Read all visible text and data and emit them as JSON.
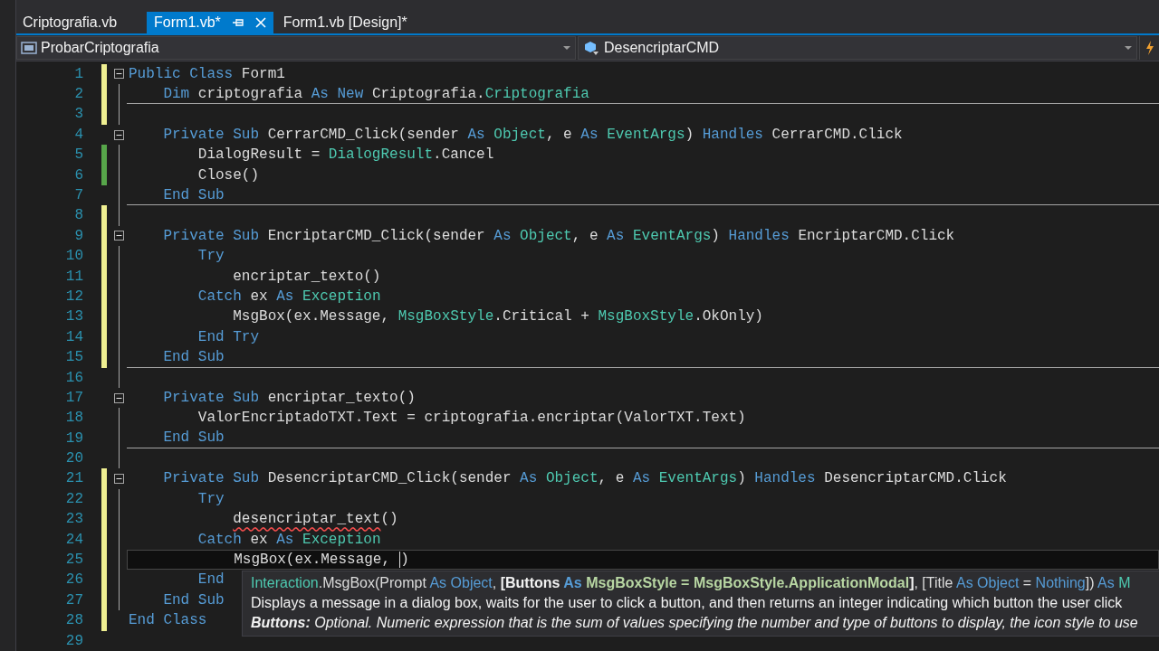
{
  "tabs": [
    {
      "label": "Criptografia.vb",
      "selected": false
    },
    {
      "label": "Form1.vb*",
      "selected": true
    },
    {
      "label": "Form1.vb [Design]*",
      "selected": false
    }
  ],
  "nav": {
    "class_dropdown": "ProbarCriptografia",
    "member_dropdown": "DesencriptarCMD"
  },
  "editor": {
    "lines": [
      {
        "number": "1",
        "color": "#efef91",
        "collapsible": true,
        "tokens": [
          {
            "kind": "keyword",
            "text": "Public Class"
          },
          {
            "kind": "plain",
            "text": " Form1"
          }
        ]
      },
      {
        "number": "2",
        "color": "#efef91",
        "separator": true,
        "tokens": [
          {
            "kind": "keyword",
            "text": "    Dim"
          },
          {
            "kind": "plain",
            "text": " criptografia "
          },
          {
            "kind": "keyword",
            "text": "As New"
          },
          {
            "kind": "plain",
            "text": " Criptografia."
          },
          {
            "kind": "type",
            "text": "Criptografia"
          }
        ]
      },
      {
        "number": "3",
        "color": "#efef91"
      },
      {
        "number": "4",
        "collapsible": true,
        "tokens": [
          {
            "kind": "keyword",
            "text": "    Private Sub"
          },
          {
            "kind": "plain",
            "text": " CerrarCMD_Click(sender "
          },
          {
            "kind": "keyword",
            "text": "As"
          },
          {
            "kind": "type",
            "text": " Object"
          },
          {
            "kind": "plain",
            "text": ", e "
          },
          {
            "kind": "keyword",
            "text": "As"
          },
          {
            "kind": "type",
            "text": " EventArgs"
          },
          {
            "kind": "plain",
            "text": ") "
          },
          {
            "kind": "keyword",
            "text": "Handles"
          },
          {
            "kind": "plain",
            "text": " CerrarCMD.Click"
          }
        ]
      },
      {
        "number": "5",
        "color": "#57a64a",
        "tokens": [
          {
            "kind": "plain",
            "text": "        DialogResult = "
          },
          {
            "kind": "type",
            "text": "DialogResult"
          },
          {
            "kind": "plain",
            "text": ".Cancel"
          }
        ]
      },
      {
        "number": "6",
        "color": "#57a64a",
        "tokens": [
          {
            "kind": "plain",
            "text": "        Close()"
          }
        ]
      },
      {
        "number": "7",
        "separator": true,
        "tokens": [
          {
            "kind": "keyword",
            "text": "    End Sub"
          }
        ]
      },
      {
        "number": "8",
        "color": "#efef91"
      },
      {
        "number": "9",
        "color": "#efef91",
        "collapsible": true,
        "tokens": [
          {
            "kind": "keyword",
            "text": "    Private Sub"
          },
          {
            "kind": "plain",
            "text": " EncriptarCMD_Click(sender "
          },
          {
            "kind": "keyword",
            "text": "As"
          },
          {
            "kind": "type",
            "text": " Object"
          },
          {
            "kind": "plain",
            "text": ", e "
          },
          {
            "kind": "keyword",
            "text": "As"
          },
          {
            "kind": "type",
            "text": " EventArgs"
          },
          {
            "kind": "plain",
            "text": ") "
          },
          {
            "kind": "keyword",
            "text": "Handles"
          },
          {
            "kind": "plain",
            "text": " EncriptarCMD.Click"
          }
        ]
      },
      {
        "number": "10",
        "color": "#efef91",
        "tokens": [
          {
            "kind": "keyword",
            "text": "        Try"
          }
        ]
      },
      {
        "number": "11",
        "color": "#efef91",
        "tokens": [
          {
            "kind": "plain",
            "text": "            encriptar_texto()"
          }
        ]
      },
      {
        "number": "12",
        "color": "#efef91",
        "tokens": [
          {
            "kind": "keyword",
            "text": "        Catch"
          },
          {
            "kind": "plain",
            "text": " ex "
          },
          {
            "kind": "keyword",
            "text": "As"
          },
          {
            "kind": "type",
            "text": " Exception"
          }
        ]
      },
      {
        "number": "13",
        "color": "#efef91",
        "tokens": [
          {
            "kind": "plain",
            "text": "            MsgBox(ex.Message, "
          },
          {
            "kind": "type",
            "text": "MsgBoxStyle"
          },
          {
            "kind": "plain",
            "text": ".Critical + "
          },
          {
            "kind": "type",
            "text": "MsgBoxStyle"
          },
          {
            "kind": "plain",
            "text": ".OkOnly)"
          }
        ]
      },
      {
        "number": "14",
        "color": "#efef91",
        "tokens": [
          {
            "kind": "keyword",
            "text": "        End Try"
          }
        ]
      },
      {
        "number": "15",
        "color": "#efef91",
        "separator": true,
        "tokens": [
          {
            "kind": "keyword",
            "text": "    End Sub"
          }
        ]
      },
      {
        "number": "16"
      },
      {
        "number": "17",
        "collapsible": true,
        "tokens": [
          {
            "kind": "keyword",
            "text": "    Private Sub"
          },
          {
            "kind": "plain",
            "text": " encriptar_texto()"
          }
        ]
      },
      {
        "number": "18",
        "tokens": [
          {
            "kind": "plain",
            "text": "        ValorEncriptadoTXT.Text = criptografia.encriptar(ValorTXT.Text)"
          }
        ]
      },
      {
        "number": "19",
        "separator": true,
        "tokens": [
          {
            "kind": "keyword",
            "text": "    End Sub"
          }
        ]
      },
      {
        "number": "20"
      },
      {
        "number": "21",
        "color": "#efef91",
        "collapsible": true,
        "tokens": [
          {
            "kind": "keyword",
            "text": "    Private Sub"
          },
          {
            "kind": "plain",
            "text": " DesencriptarCMD_Click(sender "
          },
          {
            "kind": "keyword",
            "text": "As"
          },
          {
            "kind": "type",
            "text": " Object"
          },
          {
            "kind": "plain",
            "text": ", e "
          },
          {
            "kind": "keyword",
            "text": "As"
          },
          {
            "kind": "type",
            "text": " EventArgs"
          },
          {
            "kind": "plain",
            "text": ") "
          },
          {
            "kind": "keyword",
            "text": "Handles"
          },
          {
            "kind": "plain",
            "text": " DesencriptarCMD.Click"
          }
        ]
      },
      {
        "number": "22",
        "color": "#efef91",
        "tokens": [
          {
            "kind": "keyword",
            "text": "        Try"
          }
        ]
      },
      {
        "number": "23",
        "color": "#efef91",
        "tokens": [
          {
            "kind": "error",
            "text": "            desencriptar_text"
          },
          {
            "kind": "plain",
            "text": "()"
          }
        ]
      },
      {
        "number": "24",
        "color": "#efef91",
        "tokens": [
          {
            "kind": "keyword",
            "text": "        Catch"
          },
          {
            "kind": "plain",
            "text": " ex "
          },
          {
            "kind": "keyword",
            "text": "As"
          },
          {
            "kind": "type",
            "text": " Exception"
          }
        ]
      },
      {
        "number": "25",
        "color": "#efef91",
        "current": true,
        "caret": true,
        "tokens": [
          {
            "kind": "plain",
            "text": "            MsgBox(ex.Message,"
          },
          {
            "kind": "plain",
            "text": ")"
          }
        ]
      },
      {
        "number": "26",
        "color": "#efef91",
        "tokens": [
          {
            "kind": "keyword",
            "text": "        End"
          }
        ]
      },
      {
        "number": "27",
        "color": "#efef91",
        "tokens": [
          {
            "kind": "keyword",
            "text": "    End Sub"
          }
        ]
      },
      {
        "number": "28",
        "color": "#efef91",
        "tokens": [
          {
            "kind": "keyword",
            "text": "End Class"
          }
        ]
      },
      {
        "number": "29"
      }
    ]
  },
  "tooltip": {
    "signature": [
      {
        "kind": "type",
        "text": "Interaction"
      },
      {
        "kind": "plain",
        "text": ".MsgBox(Prompt "
      },
      {
        "kind": "keyword",
        "text": "As Object"
      },
      {
        "kind": "plain",
        "text": ","
      },
      {
        "kind": "bold",
        "text": " [Buttons"
      },
      {
        "kind": "boldkeyword",
        "text": " As"
      },
      {
        "kind": "boldtype",
        "text": " MsgBoxStyle = MsgBoxStyle.ApplicationModal"
      },
      {
        "kind": "bold",
        "text": "]"
      },
      {
        "kind": "plain",
        "text": ", [Title "
      },
      {
        "kind": "keyword",
        "text": "As Object"
      },
      {
        "kind": "plain",
        "text": " ="
      },
      {
        "kind": "keyword",
        "text": " Nothing"
      },
      {
        "kind": "plain",
        "text": "])"
      },
      {
        "kind": "keyword",
        "text": " As"
      },
      {
        "kind": "type",
        "text": " M"
      }
    ],
    "description": "Displays a message in a dialog box, waits for the user to click a button, and then returns an integer indicating which button the user click",
    "parameter": "**Buttons:** Optional. Numeric expression that is the sum of values specifying the number and type of buttons to display, the icon style to use"
  }
}
